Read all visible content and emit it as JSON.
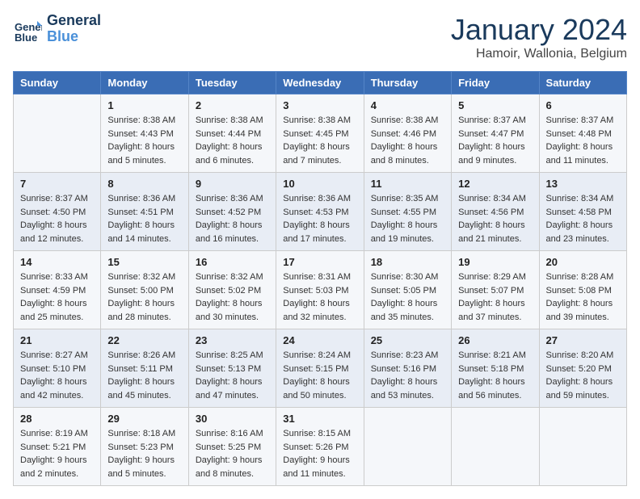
{
  "header": {
    "logo_line1": "General",
    "logo_line2": "Blue",
    "month": "January 2024",
    "location": "Hamoir, Wallonia, Belgium"
  },
  "weekdays": [
    "Sunday",
    "Monday",
    "Tuesday",
    "Wednesday",
    "Thursday",
    "Friday",
    "Saturday"
  ],
  "weeks": [
    [
      {
        "day": "",
        "info": ""
      },
      {
        "day": "1",
        "info": "Sunrise: 8:38 AM\nSunset: 4:43 PM\nDaylight: 8 hours\nand 5 minutes."
      },
      {
        "day": "2",
        "info": "Sunrise: 8:38 AM\nSunset: 4:44 PM\nDaylight: 8 hours\nand 6 minutes."
      },
      {
        "day": "3",
        "info": "Sunrise: 8:38 AM\nSunset: 4:45 PM\nDaylight: 8 hours\nand 7 minutes."
      },
      {
        "day": "4",
        "info": "Sunrise: 8:38 AM\nSunset: 4:46 PM\nDaylight: 8 hours\nand 8 minutes."
      },
      {
        "day": "5",
        "info": "Sunrise: 8:37 AM\nSunset: 4:47 PM\nDaylight: 8 hours\nand 9 minutes."
      },
      {
        "day": "6",
        "info": "Sunrise: 8:37 AM\nSunset: 4:48 PM\nDaylight: 8 hours\nand 11 minutes."
      }
    ],
    [
      {
        "day": "7",
        "info": "Sunrise: 8:37 AM\nSunset: 4:50 PM\nDaylight: 8 hours\nand 12 minutes."
      },
      {
        "day": "8",
        "info": "Sunrise: 8:36 AM\nSunset: 4:51 PM\nDaylight: 8 hours\nand 14 minutes."
      },
      {
        "day": "9",
        "info": "Sunrise: 8:36 AM\nSunset: 4:52 PM\nDaylight: 8 hours\nand 16 minutes."
      },
      {
        "day": "10",
        "info": "Sunrise: 8:36 AM\nSunset: 4:53 PM\nDaylight: 8 hours\nand 17 minutes."
      },
      {
        "day": "11",
        "info": "Sunrise: 8:35 AM\nSunset: 4:55 PM\nDaylight: 8 hours\nand 19 minutes."
      },
      {
        "day": "12",
        "info": "Sunrise: 8:34 AM\nSunset: 4:56 PM\nDaylight: 8 hours\nand 21 minutes."
      },
      {
        "day": "13",
        "info": "Sunrise: 8:34 AM\nSunset: 4:58 PM\nDaylight: 8 hours\nand 23 minutes."
      }
    ],
    [
      {
        "day": "14",
        "info": "Sunrise: 8:33 AM\nSunset: 4:59 PM\nDaylight: 8 hours\nand 25 minutes."
      },
      {
        "day": "15",
        "info": "Sunrise: 8:32 AM\nSunset: 5:00 PM\nDaylight: 8 hours\nand 28 minutes."
      },
      {
        "day": "16",
        "info": "Sunrise: 8:32 AM\nSunset: 5:02 PM\nDaylight: 8 hours\nand 30 minutes."
      },
      {
        "day": "17",
        "info": "Sunrise: 8:31 AM\nSunset: 5:03 PM\nDaylight: 8 hours\nand 32 minutes."
      },
      {
        "day": "18",
        "info": "Sunrise: 8:30 AM\nSunset: 5:05 PM\nDaylight: 8 hours\nand 35 minutes."
      },
      {
        "day": "19",
        "info": "Sunrise: 8:29 AM\nSunset: 5:07 PM\nDaylight: 8 hours\nand 37 minutes."
      },
      {
        "day": "20",
        "info": "Sunrise: 8:28 AM\nSunset: 5:08 PM\nDaylight: 8 hours\nand 39 minutes."
      }
    ],
    [
      {
        "day": "21",
        "info": "Sunrise: 8:27 AM\nSunset: 5:10 PM\nDaylight: 8 hours\nand 42 minutes."
      },
      {
        "day": "22",
        "info": "Sunrise: 8:26 AM\nSunset: 5:11 PM\nDaylight: 8 hours\nand 45 minutes."
      },
      {
        "day": "23",
        "info": "Sunrise: 8:25 AM\nSunset: 5:13 PM\nDaylight: 8 hours\nand 47 minutes."
      },
      {
        "day": "24",
        "info": "Sunrise: 8:24 AM\nSunset: 5:15 PM\nDaylight: 8 hours\nand 50 minutes."
      },
      {
        "day": "25",
        "info": "Sunrise: 8:23 AM\nSunset: 5:16 PM\nDaylight: 8 hours\nand 53 minutes."
      },
      {
        "day": "26",
        "info": "Sunrise: 8:21 AM\nSunset: 5:18 PM\nDaylight: 8 hours\nand 56 minutes."
      },
      {
        "day": "27",
        "info": "Sunrise: 8:20 AM\nSunset: 5:20 PM\nDaylight: 8 hours\nand 59 minutes."
      }
    ],
    [
      {
        "day": "28",
        "info": "Sunrise: 8:19 AM\nSunset: 5:21 PM\nDaylight: 9 hours\nand 2 minutes."
      },
      {
        "day": "29",
        "info": "Sunrise: 8:18 AM\nSunset: 5:23 PM\nDaylight: 9 hours\nand 5 minutes."
      },
      {
        "day": "30",
        "info": "Sunrise: 8:16 AM\nSunset: 5:25 PM\nDaylight: 9 hours\nand 8 minutes."
      },
      {
        "day": "31",
        "info": "Sunrise: 8:15 AM\nSunset: 5:26 PM\nDaylight: 9 hours\nand 11 minutes."
      },
      {
        "day": "",
        "info": ""
      },
      {
        "day": "",
        "info": ""
      },
      {
        "day": "",
        "info": ""
      }
    ]
  ]
}
